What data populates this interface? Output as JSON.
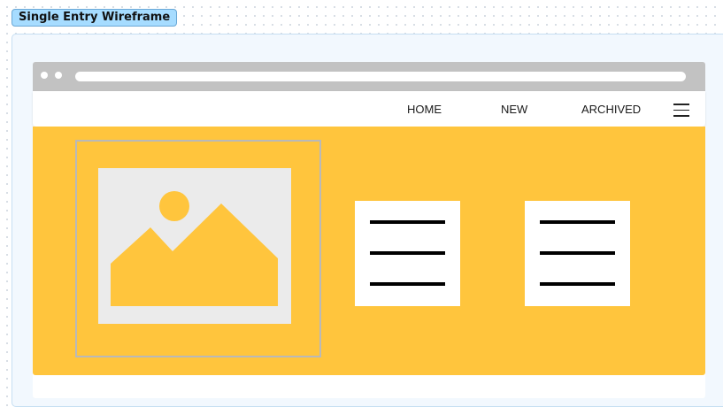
{
  "frame": {
    "label": "Single Entry Wireframe"
  },
  "nav": {
    "items": [
      {
        "label": "HOME"
      },
      {
        "label": "NEW"
      },
      {
        "label": "ARCHIVED"
      }
    ]
  },
  "icons": {
    "menu": "hamburger-menu-icon",
    "image": "image-placeholder-icon",
    "text_card": "text-lines-icon"
  },
  "colors": {
    "hero_background": "#ffc53d",
    "image_placeholder_background": "#ebebeb",
    "browser_chrome": "#c2c2c2",
    "frame_label_background": "#a6dcff"
  }
}
